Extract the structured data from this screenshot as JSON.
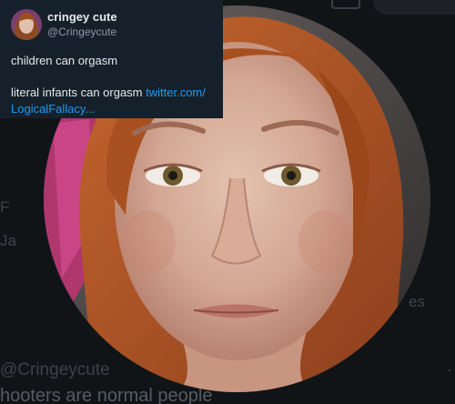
{
  "background": {
    "handle_fragment": "@Cringeycute",
    "handle_dot": "·",
    "tweet_fragment": "hooters are normal people",
    "side_fragment_right": "es",
    "side_fragment_f": "F",
    "side_fragment_ja": "Ja"
  },
  "tweet": {
    "display_name": "cringey cute",
    "handle": "@Cringeycute",
    "line1": "children can orgasm",
    "line2": "literal infants can orgasm",
    "link_part1": "twitter.com/",
    "link_part2": "LogicalFallacy..."
  },
  "colors": {
    "card_bg": "#15202b",
    "link": "#1d9bf0",
    "hair": "#b0562a"
  },
  "icons": {
    "profile_photo": "profile-photo",
    "mini_avatar": "user-avatar"
  }
}
